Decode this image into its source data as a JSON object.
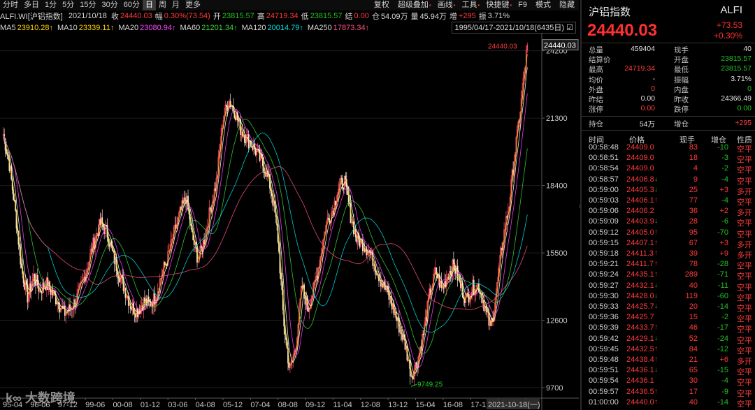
{
  "toolbar": {
    "left_tabs": [
      "分时",
      "多日",
      "1分",
      "5分",
      "15分",
      "30分",
      "60分",
      "日",
      "周",
      "月",
      "更多"
    ],
    "selected_index": 7,
    "right_items": [
      "复权",
      "超级叠加",
      "画线",
      "工具",
      "快捷键",
      "F9",
      "模式",
      "隐藏"
    ]
  },
  "info": {
    "symbol": "ALFI.WI[沪铝指数]",
    "date": "2021/10/18",
    "close_label": "收",
    "close_value": "24440.03",
    "amp_label": "幅",
    "amp_value": "0.30%(73.54)",
    "open_label": "开",
    "open_value": "23815.57",
    "high_label": "高",
    "high_value": "24719.34",
    "low_label": "低",
    "low_value": "23815.57",
    "settle_label": "结",
    "settle_value": "0.00",
    "oi_label": "仓",
    "oi_value": "54.09万",
    "vol_label": "量",
    "vol_value": "45.94万",
    "inc_label": "增",
    "inc_value": "+295",
    "zhen_label": "振",
    "zhen_value": "3.71%"
  },
  "ma": [
    {
      "label": "MA5",
      "value": "23910.28↑",
      "color": "#ffd200"
    },
    {
      "label": "MA10",
      "value": "23339.11↑",
      "color": "#ffd200"
    },
    {
      "label": "MA20",
      "value": "23080.94↑",
      "color": "#ff44ff"
    },
    {
      "label": "MA60",
      "value": "21201.34↑",
      "color": "#3ad33a"
    },
    {
      "label": "MA120",
      "value": "20014.79↑",
      "color": "#00e0e0"
    },
    {
      "label": "MA250",
      "value": "17873.34↑",
      "color": "#ff5080"
    }
  ],
  "date_range": "1995/04/17-2021/10/18(6435日)",
  "chart_data": {
    "type": "candlestick",
    "y_ticks": [
      24200,
      21300,
      18400,
      15500,
      12600,
      9700
    ],
    "ylim": [
      9250,
      24700
    ],
    "x_tick_labels": [
      "95-04",
      "96-06",
      "97-12",
      "99-06",
      "00-08",
      "01-12",
      "03-06",
      "04-08",
      "05-12",
      "07-04",
      "08-08",
      "09-12",
      "11-04",
      "12-08",
      "13-12",
      "15-04",
      "16-08",
      "17-12",
      "19-",
      "2021-10-18(一)"
    ],
    "price_tag_current": "24440.03",
    "high_annotation": "24440.03",
    "low_annotation": "9749.25",
    "close_series": [
      20600,
      19300,
      17200,
      14800,
      13600,
      14500,
      13900,
      14200,
      13800,
      13400,
      12900,
      13100,
      13500,
      14200,
      15100,
      16100,
      16800,
      16400,
      15400,
      14600,
      13900,
      13200,
      13000,
      13400,
      13300,
      13600,
      14600,
      15300,
      16300,
      17200,
      17900,
      16200,
      15200,
      16100,
      17400,
      18600,
      21200,
      22100,
      21600,
      20800,
      20400,
      20100,
      19600,
      19100,
      18200,
      16400,
      12600,
      10400,
      11500,
      14100,
      13100,
      14000,
      15300,
      16800,
      17300,
      18300,
      18600,
      17100,
      16100,
      15900,
      15600,
      15000,
      14300,
      13800,
      13100,
      12300,
      11500,
      10200,
      10900,
      12100,
      13800,
      14700,
      13900,
      14600,
      15000,
      14100,
      13500,
      14000,
      14100,
      13200,
      12200,
      14000,
      16100,
      17600,
      19900,
      22000,
      24440
    ],
    "ma_series": [
      {
        "name": "MA5",
        "color": "#ffd200"
      },
      {
        "name": "MA10",
        "color": "#ffffff"
      },
      {
        "name": "MA20",
        "color": "#ff44ff"
      },
      {
        "name": "MA60",
        "color": "#3ad33a"
      },
      {
        "name": "MA120",
        "color": "#00e0e0"
      },
      {
        "name": "MA250",
        "color": "#ff5080"
      }
    ]
  },
  "quote": {
    "name": "沪铝指数",
    "code": "ALFI",
    "last": "24440.03",
    "change": "+73.53",
    "change_pct": "+0.30%",
    "rows": [
      {
        "k": "总量",
        "v": "459404",
        "vc": "#e0e0e0",
        "k2": "现手",
        "v2": "40",
        "v2c": "#e0e0e0"
      },
      {
        "k": "结算价",
        "v": "",
        "vc": "#e0e0e0",
        "k2": "开盘",
        "v2": "23815.57",
        "v2c": "#22c422"
      },
      {
        "k": "最高",
        "v": "24719.34",
        "vc": "#ff3b3b",
        "k2": "最低",
        "v2": "23815.57",
        "v2c": "#22c422"
      },
      {
        "k": "均价",
        "v": "-",
        "vc": "#e0e0e0",
        "k2": "振幅",
        "v2": "3.71%",
        "v2c": "#e0e0e0"
      },
      {
        "k": "外盘",
        "v": "0",
        "vc": "#ff3b3b",
        "k2": "内盘",
        "v2": "0",
        "v2c": "#22c422"
      },
      {
        "k": "昨结",
        "v": "0.00",
        "vc": "#e0e0e0",
        "k2": "昨收",
        "v2": "24366.49",
        "v2c": "#e0e0e0"
      },
      {
        "k": "涨停",
        "v": "0.00",
        "vc": "#ff3b3b",
        "k2": "跌停",
        "v2": "0.00",
        "v2c": "#22c422"
      }
    ],
    "hold_label": "持仓",
    "hold_value": "54万",
    "inc_label": "增仓",
    "inc_value": "+295"
  },
  "ticks_header": [
    "时间",
    "价格",
    "现手",
    "增仓",
    "性质"
  ],
  "ticks": [
    {
      "time": "00:58:48",
      "price": "24409.0",
      "arrow": "",
      "vol": "83",
      "oi": "-10",
      "nature": "空平"
    },
    {
      "time": "00:58:51",
      "price": "24409.0",
      "arrow": "",
      "vol": "18",
      "oi": "-3",
      "nature": "空平"
    },
    {
      "time": "00:58:54",
      "price": "24409.0",
      "arrow": "",
      "vol": "4",
      "oi": "-2",
      "nature": "空平"
    },
    {
      "time": "00:58:57",
      "price": "24406.8",
      "arrow": "down",
      "vol": "9",
      "oi": "-4",
      "nature": "空平"
    },
    {
      "time": "00:59:00",
      "price": "24405.3",
      "arrow": "down",
      "vol": "25",
      "oi": "+3",
      "nature": "多开"
    },
    {
      "time": "00:59:03",
      "price": "24406.1",
      "arrow": "up",
      "vol": "77",
      "oi": "-4",
      "nature": "空平"
    },
    {
      "time": "00:59:06",
      "price": "24406.2",
      "arrow": "",
      "vol": "36",
      "oi": "+2",
      "nature": "多开"
    },
    {
      "time": "00:59:09",
      "price": "24403.9",
      "arrow": "down",
      "vol": "28",
      "oi": "-6",
      "nature": "空平"
    },
    {
      "time": "00:59:12",
      "price": "24405.0",
      "arrow": "up",
      "vol": "95",
      "oi": "-70",
      "nature": "空平"
    },
    {
      "time": "00:59:15",
      "price": "24407.1",
      "arrow": "up",
      "vol": "67",
      "oi": "+3",
      "nature": "多开"
    },
    {
      "time": "00:59:18",
      "price": "24411.3",
      "arrow": "up",
      "vol": "39",
      "oi": "+9",
      "nature": "多开"
    },
    {
      "time": "00:59:21",
      "price": "24411.7",
      "arrow": "up",
      "vol": "78",
      "oi": "-28",
      "nature": "空平"
    },
    {
      "time": "00:59:24",
      "price": "24435.1",
      "arrow": "up",
      "vol": "289",
      "oi": "-71",
      "nature": "空平"
    },
    {
      "time": "00:59:27",
      "price": "24432.1",
      "arrow": "down",
      "vol": "40",
      "oi": "-11",
      "nature": "空平"
    },
    {
      "time": "00:59:30",
      "price": "24428.0",
      "arrow": "down",
      "vol": "119",
      "oi": "-60",
      "nature": "空平"
    },
    {
      "time": "00:59:33",
      "price": "24425.7",
      "arrow": "down",
      "vol": "20",
      "oi": "-14",
      "nature": "空平"
    },
    {
      "time": "00:59:36",
      "price": "24425.7",
      "arrow": "",
      "vol": "15",
      "oi": "-2",
      "nature": "空平"
    },
    {
      "time": "00:59:39",
      "price": "24433.7",
      "arrow": "up",
      "vol": "46",
      "oi": "-17",
      "nature": "空平"
    },
    {
      "time": "00:59:42",
      "price": "24429.1",
      "arrow": "down",
      "vol": "52",
      "oi": "-24",
      "nature": "空平"
    },
    {
      "time": "00:59:45",
      "price": "24432.5",
      "arrow": "up",
      "vol": "84",
      "oi": "-12",
      "nature": "空平"
    },
    {
      "time": "00:59:48",
      "price": "24438.4",
      "arrow": "up",
      "vol": "21",
      "oi": "+6",
      "nature": "多开"
    },
    {
      "time": "00:59:51",
      "price": "24436.1",
      "arrow": "down",
      "vol": "65",
      "oi": "-15",
      "nature": "空平"
    },
    {
      "time": "00:59:54",
      "price": "24436.1",
      "arrow": "",
      "vol": "30",
      "oi": "-4",
      "nature": "空平"
    },
    {
      "time": "00:59:57",
      "price": "24436.5",
      "arrow": "up",
      "vol": "17",
      "oi": "-9",
      "nature": "空平"
    },
    {
      "time": "01:00:00",
      "price": "24440.0",
      "arrow": "up",
      "vol": "40",
      "oi": "-14",
      "nature": "空平"
    }
  ],
  "watermark": "大数跨境"
}
